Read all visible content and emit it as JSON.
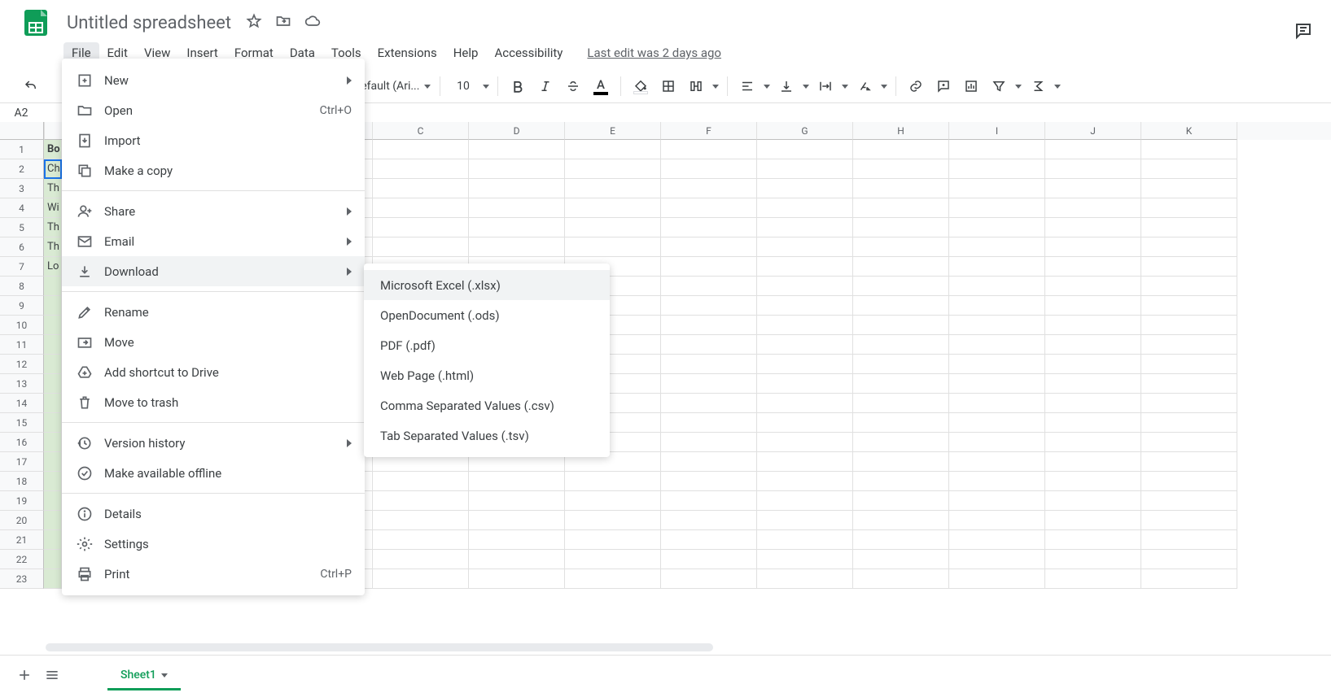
{
  "doc": {
    "title": "Untitled spreadsheet",
    "last_edit": "Last edit was 2 days ago"
  },
  "menubar": [
    "File",
    "Edit",
    "View",
    "Insert",
    "Format",
    "Data",
    "Tools",
    "Extensions",
    "Help",
    "Accessibility"
  ],
  "toolbar": {
    "font_name": "Default (Ari...",
    "font_size": "10"
  },
  "name_box": "A2",
  "columns": [
    "C",
    "D",
    "E",
    "F",
    "G",
    "H",
    "I",
    "J",
    "K"
  ],
  "rowsA": [
    "Bo",
    "Ch",
    "Th",
    "Wi",
    "Th",
    "Th",
    "Lo"
  ],
  "file_menu": [
    [
      {
        "icon": "plus-box",
        "label": "New",
        "arrow": true
      },
      {
        "icon": "folder",
        "label": "Open",
        "shortcut": "Ctrl+O"
      },
      {
        "icon": "import",
        "label": "Import"
      },
      {
        "icon": "copy",
        "label": "Make a copy"
      }
    ],
    [
      {
        "icon": "person-add",
        "label": "Share",
        "arrow": true
      },
      {
        "icon": "mail",
        "label": "Email",
        "arrow": true
      },
      {
        "icon": "download",
        "label": "Download",
        "arrow": true,
        "hover": true
      }
    ],
    [
      {
        "icon": "pencil",
        "label": "Rename"
      },
      {
        "icon": "move",
        "label": "Move"
      },
      {
        "icon": "drive-add",
        "label": "Add shortcut to Drive"
      },
      {
        "icon": "trash",
        "label": "Move to trash"
      }
    ],
    [
      {
        "icon": "history",
        "label": "Version history",
        "arrow": true
      },
      {
        "icon": "offline",
        "label": "Make available offline"
      }
    ],
    [
      {
        "icon": "info",
        "label": "Details"
      },
      {
        "icon": "gear",
        "label": "Settings"
      },
      {
        "icon": "print",
        "label": "Print",
        "shortcut": "Ctrl+P"
      }
    ]
  ],
  "download_menu": [
    "Microsoft Excel (.xlsx)",
    "OpenDocument (.ods)",
    "PDF (.pdf)",
    "Web Page (.html)",
    "Comma Separated Values (.csv)",
    "Tab Separated Values (.tsv)"
  ],
  "sheet_tab": "Sheet1"
}
